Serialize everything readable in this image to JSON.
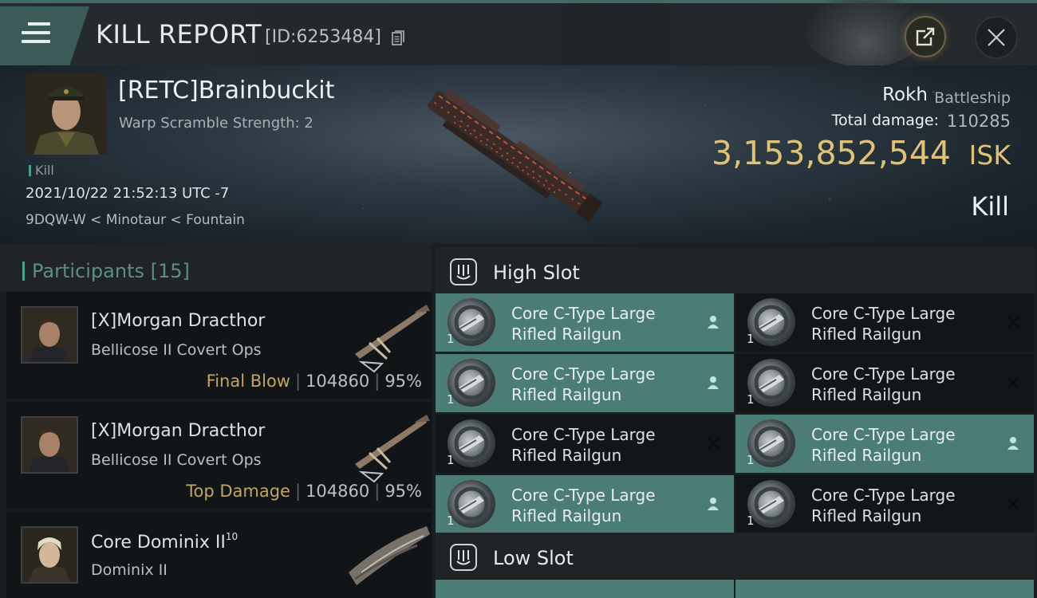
{
  "header": {
    "title": "KILL REPORT",
    "id_text": "[ID:6253484]"
  },
  "victim": {
    "name": "[RETC]Brainbuckit",
    "warp_scramble": "Warp Scramble Strength: 2",
    "tag": "Kill",
    "datetime": "2021/10/22 21:52:13 UTC -7",
    "location": "9DQW-W < Minotaur < Fountain",
    "ship_name": "Rokh",
    "ship_class": "Battleship",
    "total_damage_label": "Total damage:",
    "total_damage": "110285",
    "isk_value": "3,153,852,544",
    "isk_unit": "ISK",
    "result": "Kill"
  },
  "participants": {
    "title": "Participants",
    "count": "[15]",
    "rows": [
      {
        "name": "[X]Morgan Dracthor",
        "ship": "Bellicose II Covert Ops",
        "tag": "Final Blow",
        "damage": "104860",
        "percent": "95%"
      },
      {
        "name": "[X]Morgan Dracthor",
        "ship": "Bellicose II Covert Ops",
        "tag": "Top Damage",
        "damage": "104860",
        "percent": "95%"
      },
      {
        "name": "Core Dominix II",
        "sup": "10",
        "ship": "Dominix II"
      }
    ]
  },
  "fitting": {
    "high_slot_title": "High Slot",
    "low_slot_title": "Low Slot",
    "high_modules": [
      {
        "line1": "Core C-Type Large",
        "line2": "Rifled Railgun",
        "qty": "1",
        "state": "user-icon"
      },
      {
        "line1": "Core C-Type Large",
        "line2": "Rifled Railgun",
        "qty": "1",
        "state": "destroyed-x-icon"
      },
      {
        "line1": "Core C-Type Large",
        "line2": "Rifled Railgun",
        "qty": "1",
        "state": "user-icon"
      },
      {
        "line1": "Core C-Type Large",
        "line2": "Rifled Railgun",
        "qty": "1",
        "state": "destroyed-x-icon"
      },
      {
        "line1": "Core C-Type Large",
        "line2": "Rifled Railgun",
        "qty": "1",
        "state": "destroyed-x-icon"
      },
      {
        "line1": "Core C-Type Large",
        "line2": "Rifled Railgun",
        "qty": "1",
        "state": "user-icon"
      },
      {
        "line1": "Core C-Type Large",
        "line2": "Rifled Railgun",
        "qty": "1",
        "state": "user-icon"
      },
      {
        "line1": "Core C-Type Large",
        "line2": "Rifled Railgun",
        "qty": "1",
        "state": "destroyed-x-icon"
      }
    ]
  },
  "colors": {
    "accent": "#4aa187",
    "isk_gold": "#e0c277",
    "active_module": "#4c7c76",
    "tag_gold": "#c2a564"
  }
}
